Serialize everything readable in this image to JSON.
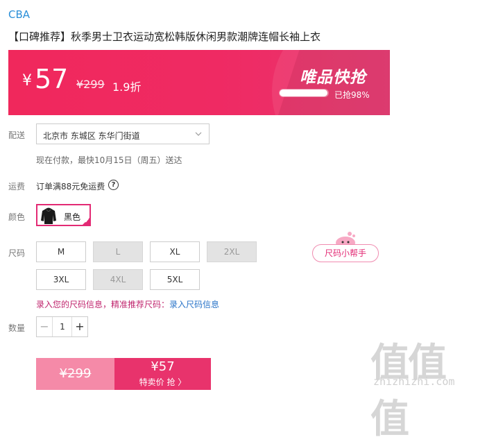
{
  "brand": "CBA",
  "product_title": "【口碑推荐】秋季男士卫衣运动宽松韩版休闲男款潮牌连帽长袖上衣",
  "banner": {
    "currency": "¥",
    "price": "57",
    "original_price": "¥299",
    "discount": "1.9折",
    "flash_title": "唯品快抢",
    "sold_text": "已抢98%",
    "sold_progress": 0.98
  },
  "shipping": {
    "label": "配送",
    "address": "北京市 东城区 东华门街道",
    "delivery_note": "现在付款，最快10月15日（周五）送达"
  },
  "fee": {
    "label": "运费",
    "text": "订单满88元免运费",
    "help_icon": "?"
  },
  "color": {
    "label": "颜色",
    "selected": "黑色",
    "check": "✔"
  },
  "size": {
    "label": "尺码",
    "options": [
      {
        "label": "M",
        "available": true
      },
      {
        "label": "L",
        "available": false
      },
      {
        "label": "XL",
        "available": true
      },
      {
        "label": "2XL",
        "available": false
      },
      {
        "label": "3XL",
        "available": true
      },
      {
        "label": "4XL",
        "available": false
      },
      {
        "label": "5XL",
        "available": true
      }
    ],
    "helper_label": "尺码小帮手",
    "info_prompt": "录入您的尺码信息，精准推荐尺码：",
    "info_link": "录入尺码信息"
  },
  "quantity": {
    "label": "数量",
    "minus": "−",
    "value": "1",
    "plus": "+"
  },
  "buy": {
    "original_price": "¥299",
    "special_price": "¥57",
    "special_label": "特卖价 抢 〉"
  },
  "watermark": {
    "text": "值值值",
    "url": "zhizhizhi.com"
  },
  "colors": {
    "accent": "#e8336c",
    "banner": "#f0285c",
    "link": "#2a74c8",
    "brand": "#2b8fd8"
  }
}
